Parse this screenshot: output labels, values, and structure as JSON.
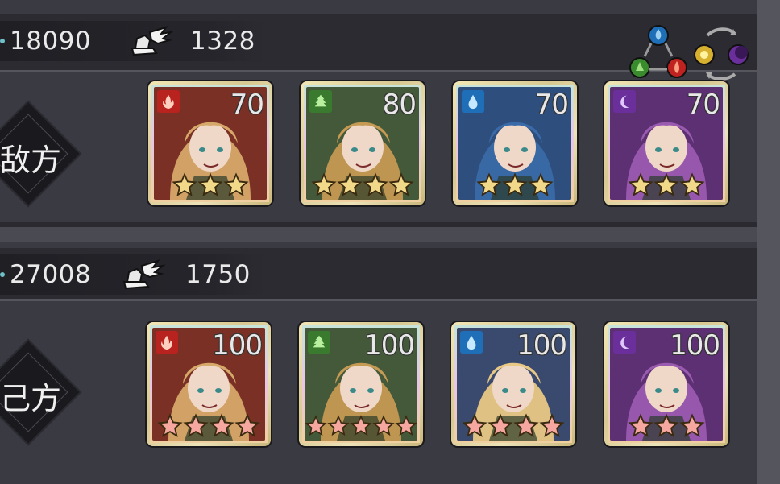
{
  "enemy": {
    "label": "敌方",
    "power": "18090",
    "speed": "1328",
    "heroes": [
      {
        "element": "fire",
        "element_icon": "flame-icon",
        "level": "70",
        "stars": 3,
        "star_color": "#f2d98a",
        "elem_color": "#b8221f",
        "bg": "#7a3024",
        "hair": "#d6a86a"
      },
      {
        "element": "nature",
        "element_icon": "leaf-icon",
        "level": "80",
        "stars": 4,
        "star_color": "#f2d98a",
        "elem_color": "#3a7a2e",
        "bg": "#44583a",
        "hair": "#c59a52"
      },
      {
        "element": "water",
        "element_icon": "water-drop-icon",
        "level": "70",
        "stars": 3,
        "star_color": "#f2d98a",
        "elem_color": "#1f6fb8",
        "bg": "#2e4f7e",
        "hair": "#3a6aa8"
      },
      {
        "element": "dark",
        "element_icon": "moon-icon",
        "level": "70",
        "stars": 3,
        "star_color": "#f2d98a",
        "elem_color": "#6a2f9a",
        "bg": "#5c3072",
        "hair": "#9a5ab0"
      }
    ]
  },
  "ally": {
    "label": "己方",
    "power": "27008",
    "speed": "1750",
    "heroes": [
      {
        "element": "fire",
        "element_icon": "flame-icon",
        "level": "100",
        "stars": 4,
        "star_color": "#f6a8a0",
        "elem_color": "#b8221f",
        "bg": "#7a3024",
        "hair": "#d6a86a"
      },
      {
        "element": "nature",
        "element_icon": "leaf-icon",
        "level": "100",
        "stars": 5,
        "star_color": "#f6a8a0",
        "elem_color": "#3a7a2e",
        "bg": "#44583a",
        "hair": "#c59a52"
      },
      {
        "element": "water",
        "element_icon": "water-drop-icon",
        "level": "100",
        "stars": 4,
        "star_color": "#f6a8a0",
        "elem_color": "#1f6fb8",
        "bg": "#3a4a6e",
        "hair": "#e8c884"
      },
      {
        "element": "dark",
        "element_icon": "moon-icon",
        "level": "100",
        "stars": 3,
        "star_color": "#f6a8a0",
        "elem_color": "#6a2f9a",
        "bg": "#5c3072",
        "hair": "#9a5ab0"
      }
    ]
  },
  "icons": {
    "speed": "winged-boot-icon",
    "element_cycle": "element-cycle-icon",
    "light_dark": "light-dark-cycle-icon"
  }
}
